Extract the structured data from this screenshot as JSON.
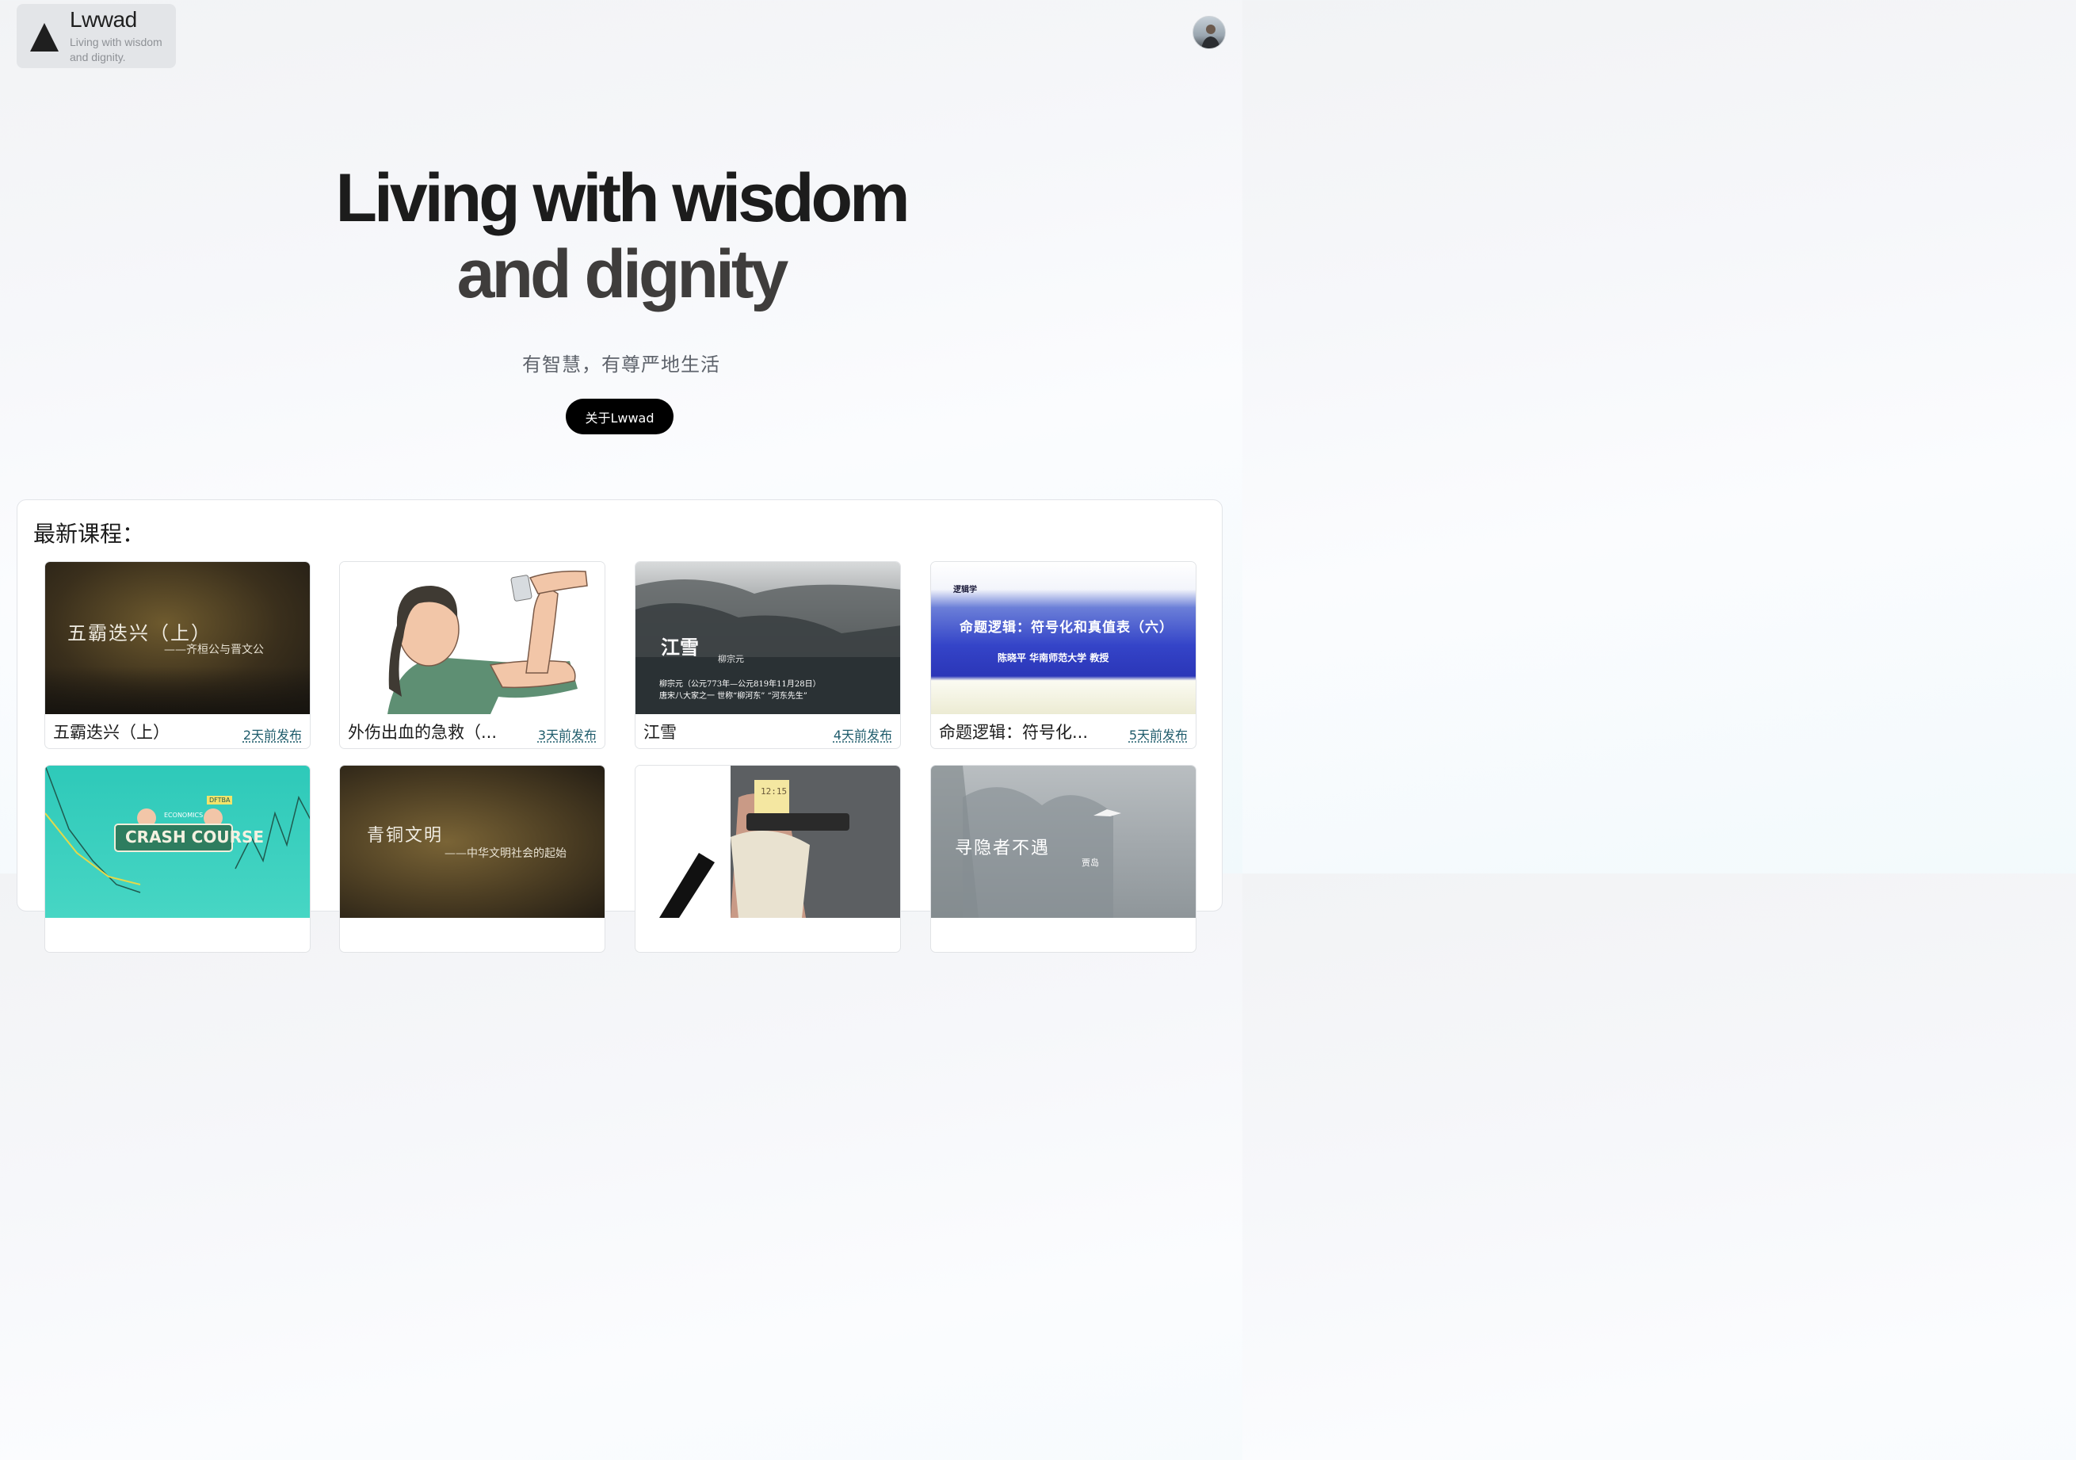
{
  "brand": {
    "title": "Lwwad",
    "subtitle": "Living with wisdom and dignity.",
    "logo_icon": "triangle-icon"
  },
  "user": {
    "avatar_icon": "user-avatar"
  },
  "hero": {
    "title_line1": "Living with wisdom",
    "title_line2": "and dignity",
    "subtitle": "有智慧，有尊严地生活",
    "button_label": "关于Lwwad"
  },
  "courses": {
    "heading": "最新课程：",
    "items": [
      {
        "name": "五霸迭兴（上）",
        "date": "2天前发布",
        "thumb_text": [
          "五霸迭兴（上）",
          "——齐桓公与晋文公"
        ]
      },
      {
        "name": "外伤出血的急救（...",
        "date": "3天前发布",
        "thumb_text": []
      },
      {
        "name": "江雪",
        "date": "4天前发布",
        "thumb_text": [
          "江雪",
          "柳宗元",
          "柳宗元（公元773年—公元819年11月28日）",
          "唐宋八大家之一 世称“柳河东” “河东先生”"
        ]
      },
      {
        "name": "命题逻辑：符号化...",
        "date": "5天前发布",
        "thumb_text": [
          "逻辑学",
          "命题逻辑：符号化和真值表（六）",
          "陈晓平  华南师范大学  教授"
        ]
      },
      {
        "name": "",
        "date": "",
        "thumb_text": [
          "CRASH COURSE",
          "ECONOMICS",
          "DFTBA"
        ]
      },
      {
        "name": "",
        "date": "",
        "thumb_text": [
          "青铜文明",
          "——中华文明社会的起始"
        ]
      },
      {
        "name": "",
        "date": "",
        "thumb_text": [
          "12:15"
        ]
      },
      {
        "name": "",
        "date": "",
        "thumb_text": [
          "寻隐者不遇",
          "贾岛"
        ]
      }
    ]
  }
}
